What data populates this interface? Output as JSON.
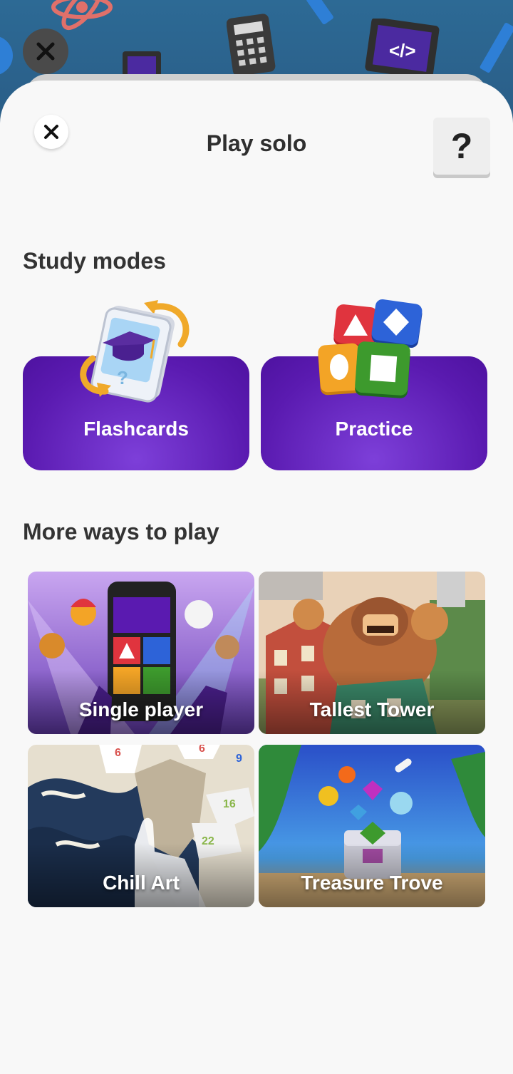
{
  "header": {
    "title": "Play solo",
    "help_label": "?"
  },
  "study_modes": {
    "heading": "Study modes",
    "items": [
      {
        "label": "Flashcards",
        "icon": "flashcards-icon"
      },
      {
        "label": "Practice",
        "icon": "practice-shapes-icon"
      }
    ]
  },
  "more_ways": {
    "heading": "More ways to play",
    "games": [
      {
        "label": "Single player"
      },
      {
        "label": "Tallest Tower"
      },
      {
        "label": "Chill Art"
      },
      {
        "label": "Treasure Trove"
      }
    ]
  },
  "colors": {
    "accent_purple": "#5a1ab0",
    "background": "#f8f8f8",
    "behind_sheet": "#2a5e88"
  }
}
